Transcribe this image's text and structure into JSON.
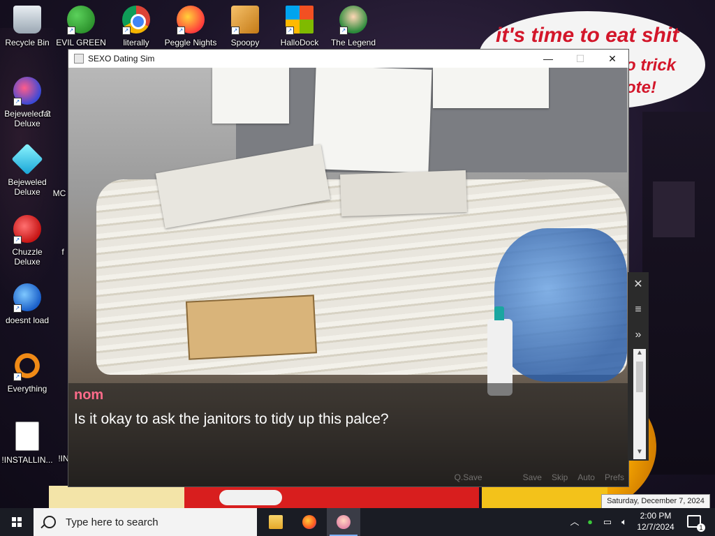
{
  "bubble": {
    "line1": "it's time to eat shit",
    "line2": "o trick",
    "line3": "ote!"
  },
  "desktop_icons": [
    {
      "label": "Recycle Bin",
      "icon": "recycle-bin-icon"
    },
    {
      "label": "EVIL GREEN M...",
      "icon": "people-icon"
    },
    {
      "label": "literally",
      "icon": "chrome-icon"
    },
    {
      "label": "Peggle Nights",
      "icon": "peggle-icon"
    },
    {
      "label": "Spoopy",
      "icon": "spoopy-icon"
    },
    {
      "label": "HalloDock",
      "icon": "windows-icon"
    },
    {
      "label": "The Legend",
      "icon": "legend-icon"
    },
    {
      "label": "Bejeweled 2 Deluxe",
      "icon": "bejeweled2-icon"
    },
    {
      "label": "fat",
      "icon": "app-icon"
    },
    {
      "label": "Bejeweled Deluxe",
      "icon": "bejeweled-icon"
    },
    {
      "label": "MC",
      "icon": "app-icon"
    },
    {
      "label": "Chuzzle Deluxe",
      "icon": "chuzzle-icon"
    },
    {
      "label": "f",
      "icon": "app-icon"
    },
    {
      "label": "doesnt load",
      "icon": "thunderbird-icon"
    },
    {
      "label": "Everything",
      "icon": "everything-icon"
    },
    {
      "label": "!INSTALLIN...",
      "icon": "document-icon"
    },
    {
      "label": "!IN",
      "icon": "document-icon"
    }
  ],
  "window": {
    "title": "SEXO Dating Sim",
    "minimize": "—",
    "maximize": "☐",
    "close": "✕"
  },
  "dialogue": {
    "speaker": "nom",
    "speaker_color": "#ff6b8a",
    "text": "Is it okay to ask the janitors to tidy up this palce?"
  },
  "quick_menu": [
    "Q.Save",
    "Save",
    "Skip",
    "Auto",
    "Prefs"
  ],
  "overlay_panel": {
    "close": "✕",
    "menu": "≡",
    "forward": "»"
  },
  "tooltip": "Saturday, December 7, 2024",
  "taskbar": {
    "search_placeholder": "Type here to search",
    "apps": [
      "File Explorer",
      "Firefox",
      "SEXO Dating Sim"
    ],
    "time": "2:00 PM",
    "date": "12/7/2024",
    "notification_count": "1"
  }
}
